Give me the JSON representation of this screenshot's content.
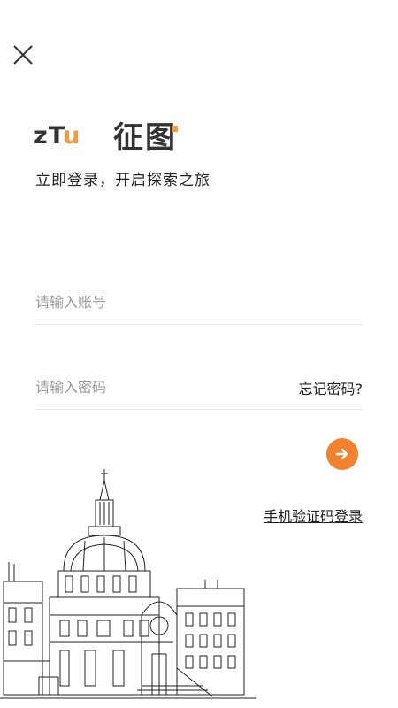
{
  "header": {
    "close_icon": "close-icon"
  },
  "brand": {
    "logo_latin_z": "z",
    "logo_latin_t": "T",
    "logo_latin_u": "u",
    "logo_cn": "征图",
    "accent_color": "#f2822d",
    "slogan": "立即登录，开启探索之旅"
  },
  "form": {
    "account_placeholder": "请输入账号",
    "account_value": "",
    "password_placeholder": "请输入密码",
    "password_value": "",
    "forgot_label": "忘记密码?",
    "submit_icon": "arrow-right-icon",
    "sms_login_label": "手机验证码登录"
  },
  "decoration": {
    "illustration": "building-sketch"
  }
}
